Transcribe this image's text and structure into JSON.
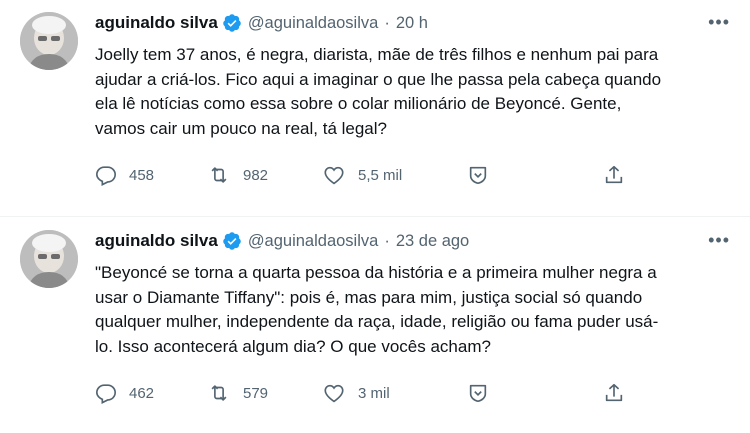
{
  "tweets": [
    {
      "author_name": "aguinaldo silva",
      "handle": "@aguinaldaosilva",
      "separator": "·",
      "time": "20 h",
      "text": "Joelly tem 37 anos, é negra, diarista, mãe de três filhos e nenhum pai para\najudar a criá-los. Fico aqui a imaginar o que lhe passa pela cabeça quando\nela lê notícias como essa sobre o colar milionário de Beyoncé. Gente,\nvamos cair um pouco na real, tá legal?",
      "replies": "458",
      "retweets": "982",
      "likes": "5,5 mil"
    },
    {
      "author_name": "aguinaldo silva",
      "handle": "@aguinaldaosilva",
      "separator": "·",
      "time": "23 de ago",
      "text": "\"Beyoncé se torna a quarta pessoa da história e a primeira mulher negra a\nusar o Diamante Tiffany\": pois é, mas para mim, justiça social só quando\nqualquer mulher, independente da raça, idade, religião ou fama puder usá-\nlo. Isso acontecerá algum dia? O que vocês acham?",
      "replies": "462",
      "retweets": "579",
      "likes": "3 mil"
    }
  ],
  "more_label": "•••",
  "colors": {
    "verified": "#1d9bf0",
    "secondary": "#536471",
    "text": "#0f1419",
    "divider": "#eff3f4"
  }
}
